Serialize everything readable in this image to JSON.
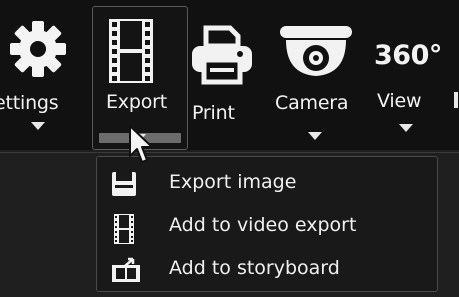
{
  "toolbar": {
    "settings_label": "ettings",
    "export_label": "Export",
    "print_label": "Print",
    "camera_label": "Camera",
    "view_label": "View",
    "view_icon_text": "360°"
  },
  "menu": {
    "items": [
      {
        "label": "Export image",
        "icon": "floppy-disk-icon"
      },
      {
        "label": "Add to video export",
        "icon": "film-strip-icon"
      },
      {
        "label": "Add to storyboard",
        "icon": "storyboard-icon"
      }
    ]
  },
  "colors": {
    "toolbar_bg": "#111111",
    "menu_bg": "#191919",
    "text": "#f0f0f0"
  }
}
